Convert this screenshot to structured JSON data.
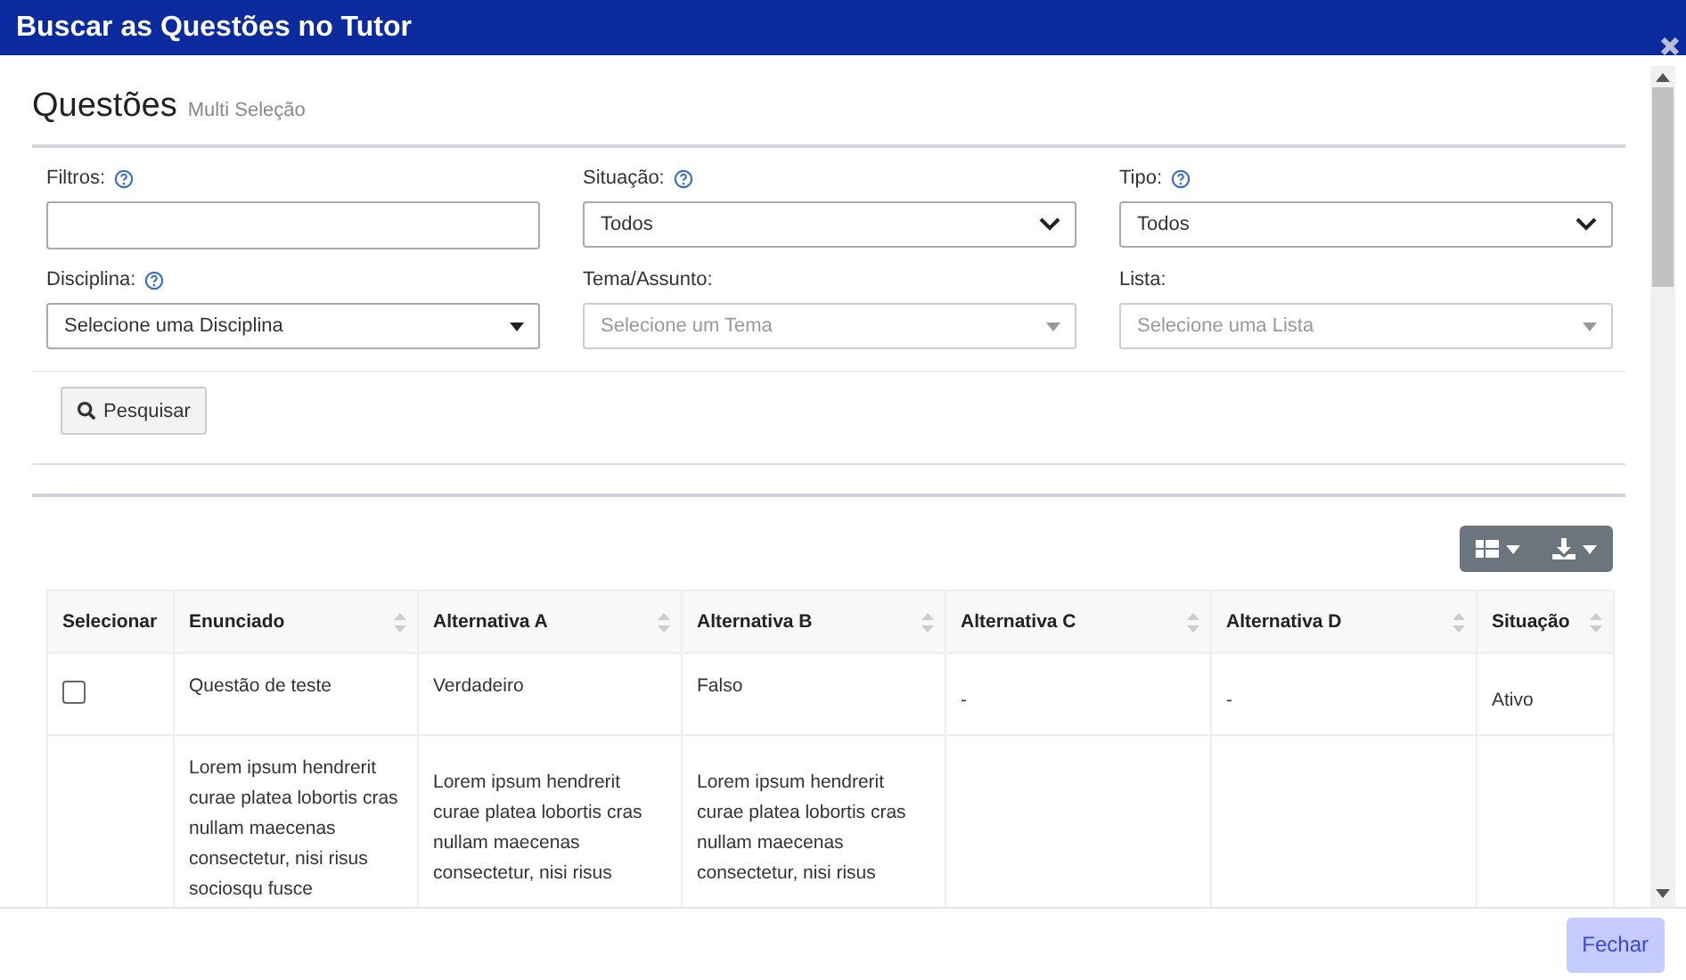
{
  "window": {
    "title": "Buscar as Questões no Tutor"
  },
  "heading": {
    "title": "Questões",
    "subtitle": "Multi Seleção"
  },
  "filters": [
    {
      "kind": "input",
      "label": "Filtros:",
      "help": true
    },
    {
      "kind": "select",
      "label": "Situação:",
      "help": true,
      "value": "Todos"
    },
    {
      "kind": "select",
      "label": "Tipo:",
      "help": true,
      "value": "Todos"
    },
    {
      "kind": "combo",
      "label": "Disciplina:",
      "help": true,
      "value": "Selecione uma Disciplina"
    },
    {
      "kind": "combo",
      "label": "Tema/Assunto:",
      "help": false,
      "placeholder": "Selecione um Tema"
    },
    {
      "kind": "combo",
      "label": "Lista:",
      "help": false,
      "placeholder": "Selecione uma Lista"
    }
  ],
  "search_button": "Pesquisar",
  "table": {
    "columns": [
      {
        "label": "Selecionar",
        "sortable": false
      },
      {
        "label": "Enunciado",
        "sortable": true
      },
      {
        "label": "Alternativa A",
        "sortable": true
      },
      {
        "label": "Alternativa B",
        "sortable": true
      },
      {
        "label": "Alternativa C",
        "sortable": true
      },
      {
        "label": "Alternativa D",
        "sortable": true
      },
      {
        "label": "Situação",
        "sortable": true
      }
    ],
    "rows": [
      {
        "cells": [
          {
            "kind": "checkbox",
            "checked": false
          },
          {
            "kind": "text",
            "text": "Questão de teste"
          },
          {
            "kind": "text",
            "text": "Verdadeiro"
          },
          {
            "kind": "text",
            "text": "Falso"
          },
          {
            "kind": "text",
            "text": "-"
          },
          {
            "kind": "text",
            "text": "-"
          },
          {
            "kind": "text",
            "text": "Ativo"
          }
        ]
      },
      {
        "cells": [
          "",
          {
            "kind": "text",
            "text": "Lorem ipsum hendrerit curae platea lobortis cras nullam maecenas consectetur, nisi risus sociosqu fusce"
          },
          {
            "kind": "text",
            "text": "Lorem ipsum hendrerit curae platea lobortis cras nullam maecenas consectetur, nisi risus"
          },
          {
            "kind": "text",
            "text": "Lorem ipsum hendrerit curae platea lobortis cras nullam maecenas consectetur, nisi risus"
          },
          "",
          "",
          ""
        ]
      }
    ]
  },
  "footer": {
    "close_button": "Fechar"
  }
}
